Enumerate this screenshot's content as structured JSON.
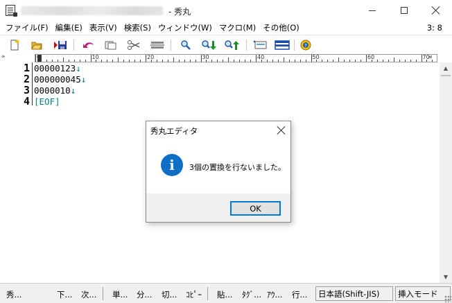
{
  "window": {
    "title_suffix": "- 秀丸",
    "cursor_position": "3: 8"
  },
  "menu": [
    "ファイル(F)",
    "編集(E)",
    "表示(V)",
    "検索(S)",
    "ウィンドウ(W)",
    "マクロ(M)",
    "その他(O)"
  ],
  "toolbar": {
    "icons": [
      "new-file-icon",
      "open-folder-icon",
      "save-icon",
      "undo-icon",
      "copy-icon",
      "cut-icon",
      "paste-icon",
      "search-icon",
      "search-down-icon",
      "search-up-icon",
      "replace-icon",
      "split-window-icon",
      "help-icon"
    ]
  },
  "ruler": {
    "corner": "»",
    "labels": [
      "0",
      "10",
      "20",
      "30",
      "40",
      "50",
      "60",
      "70"
    ],
    "end_marker": "«"
  },
  "editor": {
    "lines": [
      {
        "num": "1",
        "text": "00000123",
        "eol": "↓"
      },
      {
        "num": "2",
        "text": "000000045",
        "eol": "↓"
      },
      {
        "num": "3",
        "text": "0000010",
        "eol": "↓"
      },
      {
        "num": "4",
        "text": "",
        "eol": "[EOF]"
      }
    ]
  },
  "dialog": {
    "title": "秀丸エディタ",
    "message": "3個の置換を行ないました。",
    "icon": "information-icon",
    "ok_label": "OK"
  },
  "statusbar": {
    "items": [
      "秀...",
      "下...",
      "次...",
      "単...",
      "分...",
      "切...",
      "ｺﾋﾟｰ",
      "貼...",
      "ﾀｸﾞ...",
      "ｱｳ...",
      "行..."
    ],
    "encoding": "日本語(Shift-JIS)",
    "mode": "挿入モード"
  }
}
